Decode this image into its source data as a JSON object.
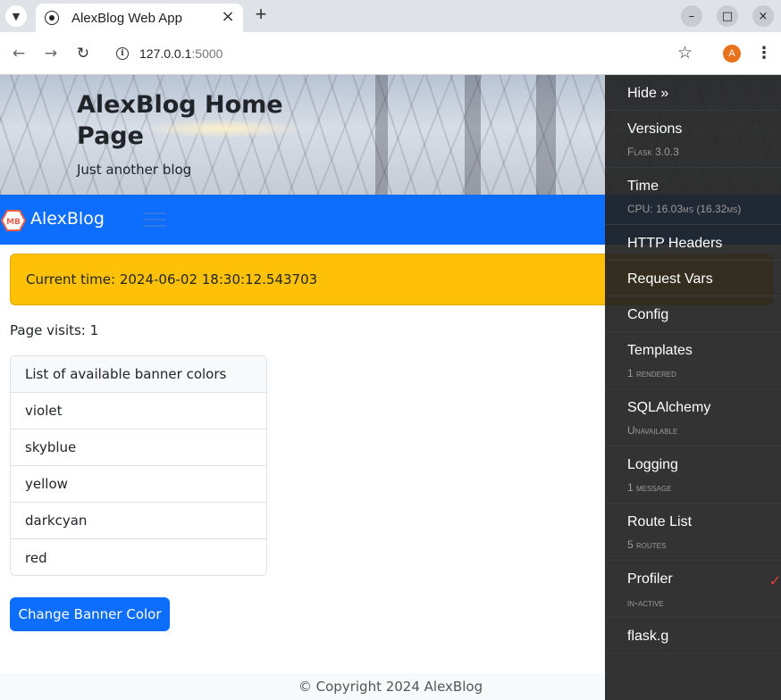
{
  "browser": {
    "tab_title": "AlexBlog Web App",
    "url_host": "127.0.0.1",
    "url_port": ":5000",
    "profile_initial": "A"
  },
  "page": {
    "hero_title": "AlexBlog Home Page",
    "hero_subtitle": "Just another blog",
    "brand_logo_text": "MB",
    "brand_name": "AlexBlog",
    "alert_text": "Current time: 2024-06-02 18:30:12.543703",
    "visits_text": "Page visits: 1",
    "colors_card": {
      "header": "List of available banner colors",
      "items": [
        "violet",
        "skyblue",
        "yellow",
        "darkcyan",
        "red"
      ]
    },
    "change_button_label": "Change Banner Color",
    "footer_text": "© Copyright 2024 AlexBlog"
  },
  "debug_toolbar": {
    "hide_label": "Hide »",
    "panels": [
      {
        "title": "Versions",
        "subtitle": "Flask 3.0.3"
      },
      {
        "title": "Time",
        "subtitle": "CPU: 16.03ms (16.32ms)"
      },
      {
        "title": "HTTP Headers",
        "subtitle": ""
      },
      {
        "title": "Request Vars",
        "subtitle": ""
      },
      {
        "title": "Config",
        "subtitle": ""
      },
      {
        "title": "Templates",
        "subtitle": "1 rendered"
      },
      {
        "title": "SQLAlchemy",
        "subtitle": "Unavailable"
      },
      {
        "title": "Logging",
        "subtitle": "1 message"
      },
      {
        "title": "Route List",
        "subtitle": "5 routes"
      },
      {
        "title": "Profiler",
        "subtitle": "in-active"
      },
      {
        "title": "flask.g",
        "subtitle": ""
      }
    ]
  }
}
